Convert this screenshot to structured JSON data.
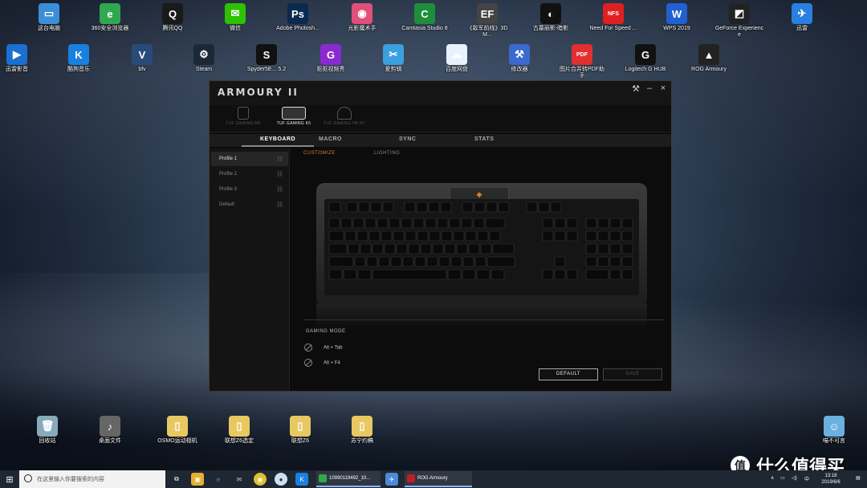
{
  "desktop": {
    "top_row": [
      {
        "label": "这台电脑",
        "icon": "computer-icon",
        "color": "#3a8fd8",
        "glyph": "▭"
      },
      {
        "label": "360安全浏览器",
        "icon": "browser-360-icon",
        "color": "#2fa84f",
        "glyph": "e"
      },
      {
        "label": "腾讯QQ",
        "icon": "qq-icon",
        "color": "#1a1a1a",
        "glyph": "Q"
      },
      {
        "label": "微信",
        "icon": "wechat-icon",
        "color": "#2dc100",
        "glyph": "✉"
      },
      {
        "label": "Adobe Photosh...",
        "icon": "photoshop-icon",
        "color": "#0a2a4f",
        "glyph": "Ps"
      },
      {
        "label": "光影魔术手",
        "icon": "nikon-icon",
        "color": "#e0507a",
        "glyph": "◉"
      },
      {
        "label": "Camtasia Studio 8",
        "icon": "camtasia-icon",
        "color": "#1d8f3a",
        "glyph": "C"
      },
      {
        "label": "《敌军前线》3DM...",
        "icon": "enemy-front-icon",
        "color": "#444",
        "glyph": "EF"
      },
      {
        "label": "古墓丽影-暗影",
        "icon": "tomb-raider-icon",
        "color": "#111",
        "glyph": "◐"
      },
      {
        "label": "Need For Speed ...",
        "icon": "nfs-icon",
        "color": "#e02020",
        "glyph": "NFS"
      },
      {
        "label": "WPS 2019",
        "icon": "wps-icon",
        "color": "#2060d0",
        "glyph": "W"
      },
      {
        "label": "GeForce Experience",
        "icon": "geforce-icon",
        "color": "#222",
        "glyph": "◩"
      },
      {
        "label": "迅雷",
        "icon": "thunder-icon",
        "color": "#2a80e0",
        "glyph": "✈"
      }
    ],
    "second_row": [
      {
        "label": "迅雷影音",
        "icon": "xunlei-player-icon",
        "color": "#1a70d0",
        "glyph": "▶"
      },
      {
        "label": "酷狗音乐",
        "icon": "kugou-icon",
        "color": "#1a80e0",
        "glyph": "K"
      },
      {
        "label": "bfv",
        "icon": "bfv-icon",
        "color": "#2a4a7a",
        "glyph": "V"
      },
      {
        "label": "Steam",
        "icon": "steam-icon",
        "color": "#1b2838",
        "glyph": "⚙"
      },
      {
        "label": "Spyder5E... 5.2",
        "icon": "spyder-icon",
        "color": "#111",
        "glyph": "S"
      },
      {
        "label": "抠抠视频秀",
        "icon": "koukou-icon",
        "color": "#8a2ad0",
        "glyph": "G"
      },
      {
        "label": "爱剪辑",
        "icon": "aijianji-icon",
        "color": "#3aa0e0",
        "glyph": "✂"
      },
      {
        "label": "百度网盘",
        "icon": "baidu-pan-icon",
        "color": "#e8f2ff",
        "glyph": "☁"
      },
      {
        "label": "修改器",
        "icon": "trainer-icon",
        "color": "#3a6ad0",
        "glyph": "⚒"
      },
      {
        "label": "图片合并转PDF助手",
        "icon": "pdf-helper-icon",
        "color": "#e03030",
        "glyph": "PDF"
      },
      {
        "label": "Logitech G HUB",
        "icon": "logitech-icon",
        "color": "#111",
        "glyph": "G"
      },
      {
        "label": "ROG Armoury",
        "icon": "rog-armoury-icon",
        "color": "#222",
        "glyph": "▲"
      }
    ],
    "bottom_row": [
      {
        "label": "回收站",
        "icon": "recycle-bin-icon",
        "color": "#8ab",
        "glyph": "🗑"
      },
      {
        "label": "桌面文件",
        "icon": "folder-speaker-icon",
        "color": "#666",
        "glyph": "♪"
      },
      {
        "label": "OSMO运动相机",
        "icon": "osmo-folder-icon",
        "color": "#e8c860",
        "glyph": "▯"
      },
      {
        "label": "联想Z6选定",
        "icon": "z6-folder-icon",
        "color": "#e8c860",
        "glyph": "▯"
      },
      {
        "label": "联想Z6",
        "icon": "z6-folder-icon",
        "color": "#e8c860",
        "glyph": "▯"
      },
      {
        "label": "苏宁约稿",
        "icon": "suning-folder-icon",
        "color": "#e8c860",
        "glyph": "▯"
      }
    ],
    "corner_icon": {
      "label": "喵不可言",
      "icon": "cat-app-icon",
      "color": "#6ab0e0",
      "glyph": "☺"
    }
  },
  "window": {
    "title": "ARMOURY II",
    "devices": [
      {
        "label": "TUF GAMING M5",
        "active": false
      },
      {
        "label": "TUF GAMING K5",
        "active": true
      },
      {
        "label": "TUF GAMING H5 H7",
        "active": false
      }
    ],
    "tabs": [
      "KEYBOARD",
      "MACRO",
      "SYNC",
      "STATS"
    ],
    "profiles": [
      "Profile 1",
      "Profile 2",
      "Profile 3",
      "Default"
    ],
    "subtabs": {
      "customize": "CUSTOMIZE",
      "lighting": "LIGHTING"
    },
    "gaming_mode": {
      "title": "GAMING MODE",
      "items": [
        "Alt + Tab",
        "Alt + F4"
      ]
    },
    "buttons": {
      "default": "DEFAULT",
      "save": "SAVE"
    },
    "accent": "#d08030"
  },
  "taskbar": {
    "search_placeholder": "在这里输入你要搜索的内容",
    "apps": [
      {
        "label": "10990119492_10...",
        "color": "#2fa84f"
      },
      {
        "label": "ROG Armoury",
        "color": "#c02020"
      }
    ],
    "ime": "中",
    "time": "13:18",
    "date": "2019/6/6"
  },
  "watermark": {
    "glyph": "值",
    "text": "什么值得买"
  }
}
